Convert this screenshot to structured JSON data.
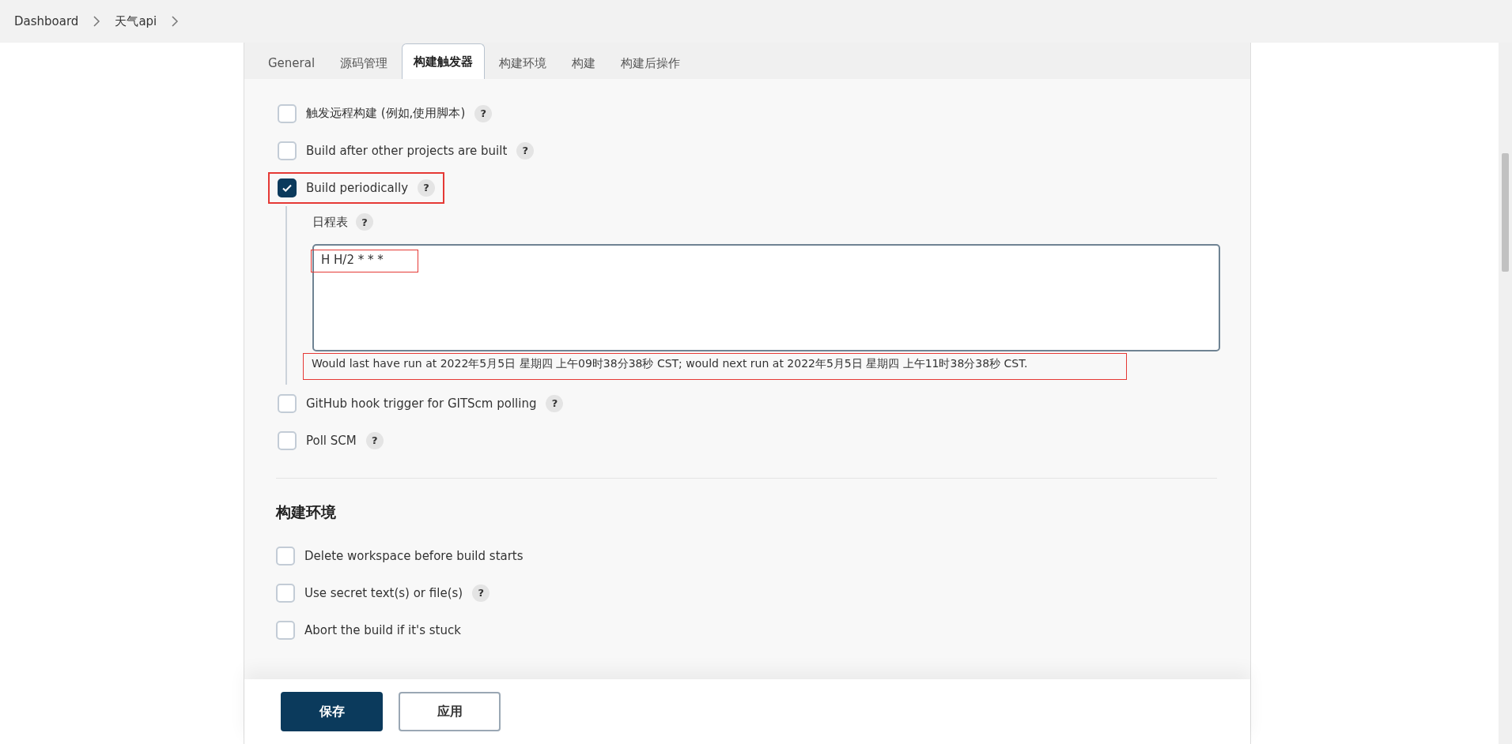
{
  "breadcrumbs": [
    "Dashboard",
    "天气api"
  ],
  "tabs": [
    {
      "label": "General",
      "selected": false
    },
    {
      "label": "源码管理",
      "selected": false
    },
    {
      "label": "构建触发器",
      "selected": true
    },
    {
      "label": "构建环境",
      "selected": false
    },
    {
      "label": "构建",
      "selected": false
    },
    {
      "label": "构建后操作",
      "selected": false
    }
  ],
  "triggers": [
    {
      "label": "触发远程构建 (例如,使用脚本)",
      "checked": false,
      "help": "?",
      "annotated": false
    },
    {
      "label": "Build after other projects are built",
      "checked": false,
      "help": "?",
      "annotated": false
    },
    {
      "label": "Build periodically",
      "checked": true,
      "help": "?",
      "annotated": true,
      "schedule": {
        "label": "日程表",
        "help": "?",
        "value": "H H/2 * * *",
        "annotated": true,
        "note": "Would last have run at 2022年5月5日 星期四 上午09时38分38秒 CST; would next run at 2022年5月5日 星期四 上午11时38分38秒 CST.",
        "note_annotated": true
      }
    },
    {
      "label": "GitHub hook trigger for GITScm polling",
      "checked": false,
      "help": "?",
      "annotated": false
    },
    {
      "label": "Poll SCM",
      "checked": false,
      "help": "?",
      "annotated": false
    }
  ],
  "build_environment": {
    "heading": "构建环境",
    "items": [
      {
        "label": "Delete workspace before build starts",
        "checked": false
      },
      {
        "label": "Use secret text(s) or file(s)",
        "checked": false,
        "help": "?"
      },
      {
        "label": "Abort the build if it's stuck",
        "checked": false
      }
    ]
  },
  "buttons": [
    {
      "label": "保存",
      "kind": "primary"
    },
    {
      "label": "应用",
      "kind": "secondary"
    }
  ]
}
